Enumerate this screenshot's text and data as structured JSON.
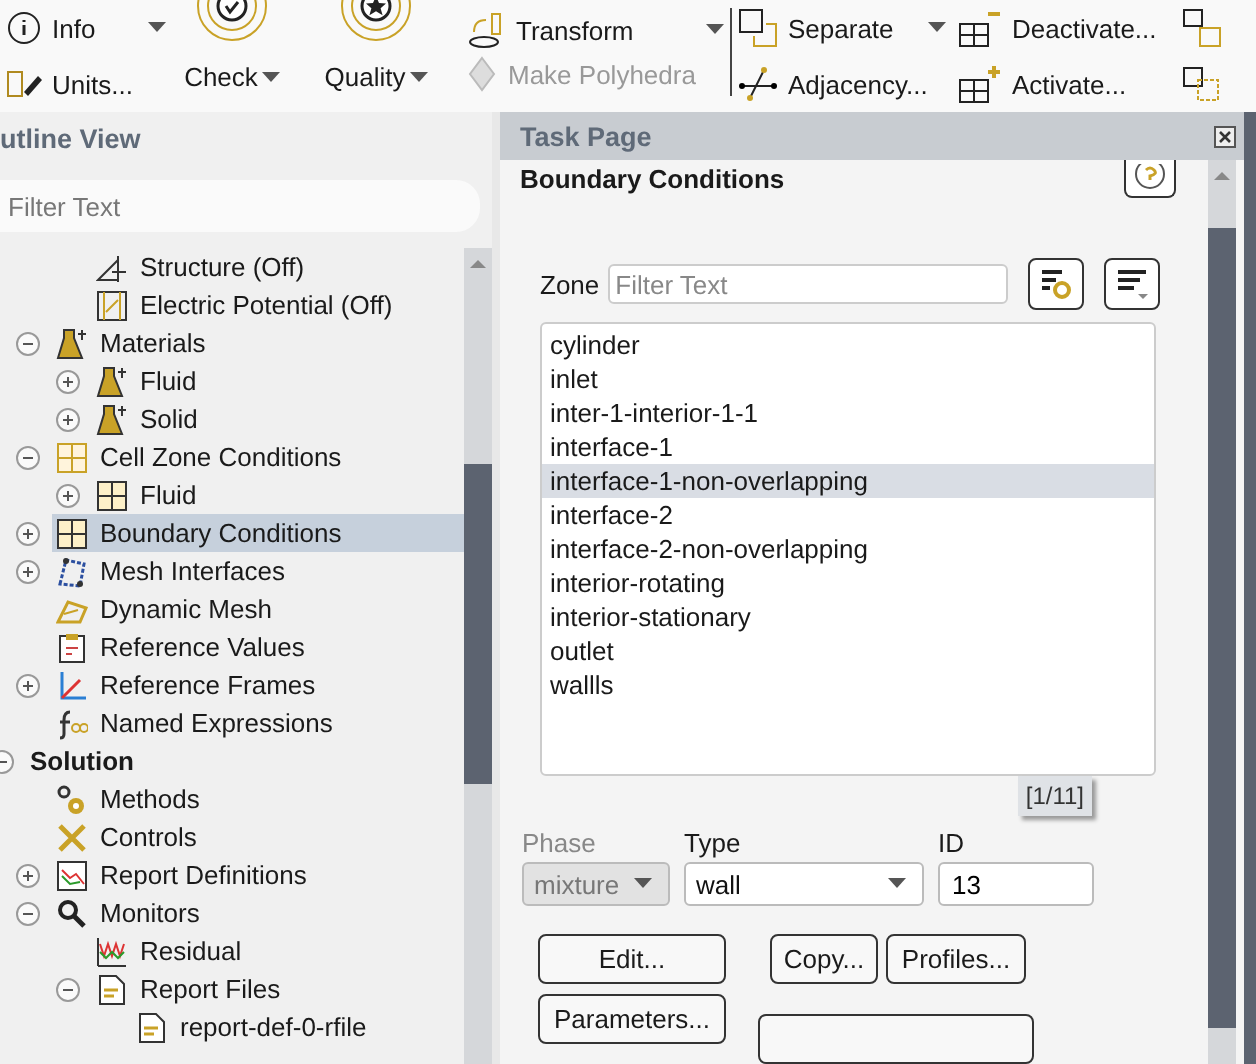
{
  "ribbon": {
    "groups": [
      {
        "items": [
          {
            "kind": "small",
            "label": "Info",
            "dropdown": true,
            "disabled": false
          },
          {
            "kind": "small",
            "label": "Units...",
            "disabled": false
          }
        ]
      },
      {
        "items": [
          {
            "kind": "large",
            "label": "Check",
            "dropdown": true,
            "disabled": false
          }
        ]
      },
      {
        "items": [
          {
            "kind": "large",
            "label": "Quality",
            "dropdown": true,
            "disabled": false
          }
        ]
      },
      {
        "items": [
          {
            "kind": "small",
            "label": "Transform",
            "dropdown": true,
            "disabled": false
          },
          {
            "kind": "small",
            "label": "Make Polyhedra",
            "disabled": true
          }
        ]
      },
      {
        "items": [
          {
            "kind": "small",
            "label": "Separate",
            "dropdown": true,
            "disabled": false
          },
          {
            "kind": "small",
            "label": "Adjacency...",
            "disabled": false
          }
        ]
      },
      {
        "items": [
          {
            "kind": "small",
            "label": "Deactivate...",
            "disabled": false
          },
          {
            "kind": "small",
            "label": "Activate...",
            "disabled": false
          }
        ]
      }
    ]
  },
  "outline": {
    "title": "utline View",
    "filter": {
      "placeholder": "Filter Text"
    },
    "nodes": [
      {
        "children": [
          {
            "children": [
              {
                "kind": "structure",
                "label": "Structure (Off)",
                "selected": false
              },
              {
                "kind": "electric",
                "label": "Electric Potential (Off)",
                "selected": false
              }
            ]
          },
          {
            "kind": "material",
            "label": "Materials",
            "expanded": true,
            "selected": false,
            "children": [
              {
                "kind": "material",
                "label": "Fluid",
                "expanded": false,
                "selected": false
              },
              {
                "kind": "material",
                "label": "Solid",
                "expanded": false,
                "selected": false
              }
            ]
          },
          {
            "kind": "cellzone",
            "label": "Cell Zone Conditions",
            "expanded": true,
            "selected": false,
            "children": [
              {
                "kind": "zone",
                "label": "Fluid",
                "expanded": false,
                "selected": false
              }
            ]
          },
          {
            "kind": "zone",
            "label": "Boundary Conditions",
            "expanded": false,
            "selected": true
          },
          {
            "kind": "mesh",
            "label": "Mesh Interfaces",
            "expanded": false,
            "selected": false
          },
          {
            "kind": "dynamic",
            "label": "Dynamic Mesh",
            "selected": false
          },
          {
            "kind": "refvalues",
            "label": "Reference Values",
            "selected": false
          },
          {
            "kind": "frames",
            "label": "Reference Frames",
            "expanded": false,
            "selected": false
          },
          {
            "kind": "expression",
            "label": "Named Expressions",
            "selected": false
          }
        ]
      },
      {
        "label": "Solution",
        "expanded": true,
        "selected": false,
        "children": [
          {
            "kind": "methods",
            "label": "Methods",
            "selected": false
          },
          {
            "kind": "controls",
            "label": "Controls",
            "selected": false
          },
          {
            "kind": "reportdef",
            "label": "Report Definitions",
            "expanded": false,
            "selected": false
          },
          {
            "kind": "monitor",
            "label": "Monitors",
            "expanded": true,
            "selected": false,
            "children": [
              {
                "kind": "residual",
                "label": "Residual",
                "selected": false
              },
              {
                "kind": "file",
                "label": "Report Files",
                "expanded": true,
                "selected": false,
                "children": [
                  {
                    "kind": "file",
                    "label": "report-def-0-rfile",
                    "selected": false
                  }
                ]
              }
            ]
          }
        ]
      }
    ]
  },
  "task_page": {
    "title": "Task Page",
    "heading": "Boundary Conditions",
    "zone_label": "Zone",
    "zone_filter": {
      "placeholder": "Filter Text"
    },
    "zones": [
      {
        "label": "cylinder",
        "selected": false
      },
      {
        "label": "inlet",
        "selected": false
      },
      {
        "label": "inter-1-interior-1-1",
        "selected": false
      },
      {
        "label": "interface-1",
        "selected": false
      },
      {
        "label": "interface-1-non-overlapping",
        "selected": true
      },
      {
        "label": "interface-2",
        "selected": false
      },
      {
        "label": "interface-2-non-overlapping",
        "selected": false
      },
      {
        "label": "interior-rotating",
        "selected": false
      },
      {
        "label": "interior-stationary",
        "selected": false
      },
      {
        "label": "outlet",
        "selected": false
      },
      {
        "label": "wallls",
        "selected": false
      }
    ],
    "count_tooltip": "[1/11]",
    "phase": {
      "label": "Phase",
      "value": "mixture",
      "disabled": true
    },
    "type": {
      "label": "Type",
      "value": "wall",
      "disabled": false
    },
    "id": {
      "label": "ID",
      "value": "13"
    },
    "buttons": [
      "Edit...",
      "Copy...",
      "Profiles...",
      "Parameters..."
    ]
  }
}
